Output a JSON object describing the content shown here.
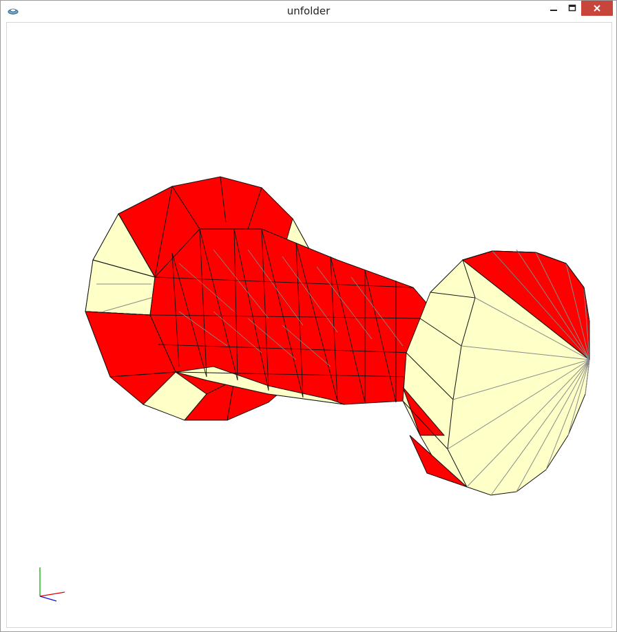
{
  "window": {
    "title": "unfolder",
    "app_icon": "app-logo-icon",
    "controls": {
      "minimize_icon": "minimize-icon",
      "maximize_icon": "maximize-icon",
      "close_icon": "close-icon",
      "close_color": "#c7453a"
    }
  },
  "viewport": {
    "model": "3d-mesh-dumbbell",
    "colors": {
      "face_red": "#ff0000",
      "face_cream": "#ffffc8",
      "edge_dark": "#111111",
      "edge_light": "#8a8a8a",
      "background": "#ffffff"
    },
    "axes_gizmo": {
      "x_color": "#e00000",
      "y_color": "#00b000",
      "z_color": "#1010d0"
    }
  }
}
